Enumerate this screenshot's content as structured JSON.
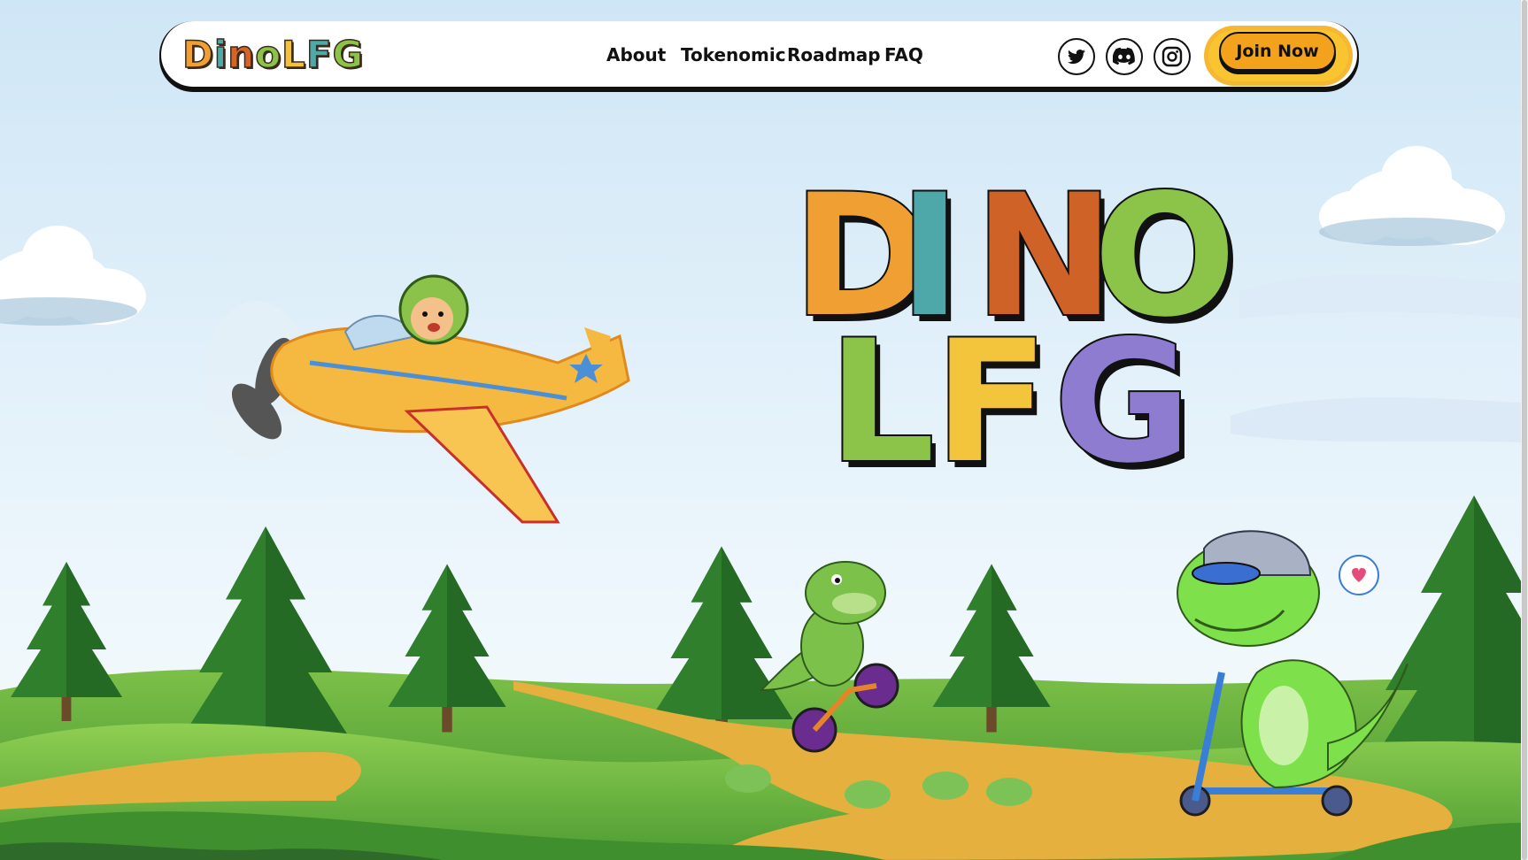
{
  "brand": {
    "logo_letters": [
      {
        "char": "D",
        "color": "#f0a033"
      },
      {
        "char": "i",
        "color": "#4fa9a9"
      },
      {
        "char": "n",
        "color": "#d4642a"
      },
      {
        "char": "o",
        "color": "#8bc34a"
      },
      {
        "char": "L",
        "color": "#f3c13a"
      },
      {
        "char": "F",
        "color": "#4fa9a9"
      },
      {
        "char": "G",
        "color": "#8bc34a"
      }
    ]
  },
  "nav": {
    "links": [
      "About",
      "Tokenomic",
      "Roadmap",
      "FAQ"
    ],
    "social": [
      {
        "icon": "twitter-icon"
      },
      {
        "icon": "discord-icon"
      },
      {
        "icon": "instagram-icon"
      }
    ],
    "cta_label": "Join Now"
  },
  "hero": {
    "title_line1": [
      {
        "char": "D",
        "color": "#f0a033"
      },
      {
        "char": "I",
        "color": "#4ea8aa"
      },
      {
        "char": "N",
        "color": "#cf6226"
      },
      {
        "char": "O",
        "color": "#8cc44a"
      }
    ],
    "title_line2": [
      {
        "char": "L",
        "color": "#8cc44a"
      },
      {
        "char": "F",
        "color": "#f3c53c"
      },
      {
        "char": "G",
        "color": "#8e7cd1"
      }
    ]
  },
  "colors": {
    "sky_top": "#cfe6f6",
    "sky_bottom": "#f1f8fd",
    "grass": "#5aa83a",
    "path": "#e6b03f",
    "tree": "#2f7a2a",
    "cta": "#f3a21b"
  }
}
